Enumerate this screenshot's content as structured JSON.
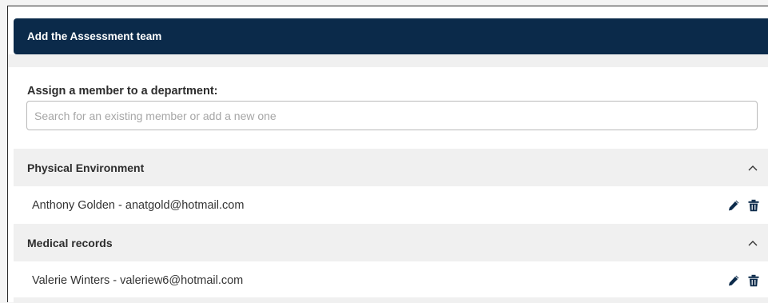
{
  "header": {
    "title": "Add the Assessment team"
  },
  "assign": {
    "label": "Assign a member to a department:",
    "search_placeholder": "Search for an existing member or add a new one",
    "search_value": ""
  },
  "departments": [
    {
      "name": "Physical Environment",
      "expanded": true,
      "members": [
        {
          "text": "Anthony Golden - anatgold@hotmail.com"
        }
      ]
    },
    {
      "name": "Medical records",
      "expanded": true,
      "members": [
        {
          "text": "Valerie Winters - valeriew6@hotmail.com"
        }
      ]
    }
  ],
  "icons": {
    "collapse": "chevron-up-icon",
    "edit": "pencil-icon",
    "delete": "trash-icon"
  },
  "colors": {
    "header_bg": "#0b2a4a",
    "header_text": "#ffffff",
    "section_bg": "#f0f0f0",
    "icon_color": "#0b2a4a"
  }
}
